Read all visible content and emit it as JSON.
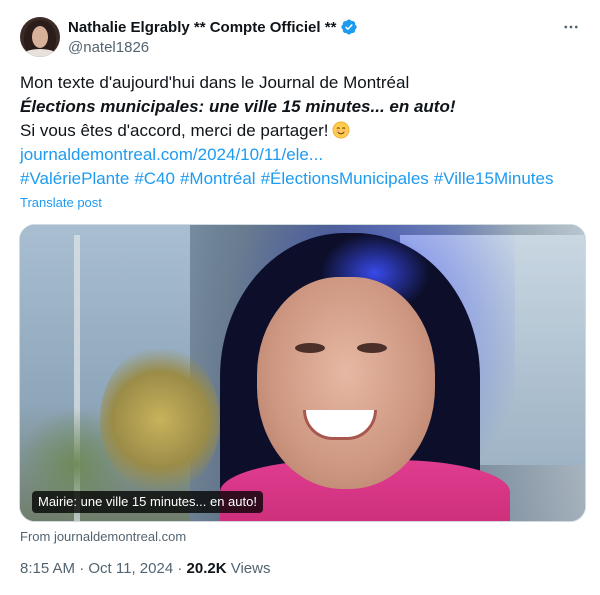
{
  "author": {
    "display_name": "Nathalie Elgrably ** Compte Officiel **",
    "handle": "@natel1826",
    "verified_icon": "verified-badge-icon"
  },
  "post": {
    "line1": "Mon texte d'aujourd'hui dans le Journal de Montréal",
    "headline": "Élections municipales: une ville 15 minutes... en auto!",
    "line3": "Si vous êtes d'accord, merci de partager!",
    "emoji": "smiling-face-icon",
    "link": "journaldemontreal.com/2024/10/11/ele...",
    "hashtags": [
      "#ValériePlante",
      "#C40",
      "#Montréal",
      "#ÉlectionsMunicipales",
      "#Ville15Minutes"
    ],
    "translate_label": "Translate post"
  },
  "card": {
    "caption": "Mairie: une ville 15 minutes... en auto!",
    "source": "From journaldemontreal.com"
  },
  "meta": {
    "time": "8:15 AM",
    "separator": "·",
    "date": "Oct 11, 2024",
    "views_count": "20.2K",
    "views_label": "Views"
  },
  "colors": {
    "link": "#1d9bf0",
    "text": "#0f1419",
    "muted": "#536471"
  }
}
